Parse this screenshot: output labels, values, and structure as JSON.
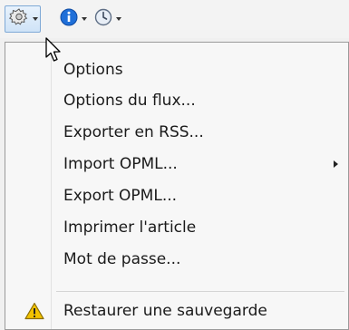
{
  "toolbar": {
    "buttons": [
      {
        "icon": "gear-icon",
        "has_dropdown": true,
        "active": true
      },
      {
        "icon": "info-icon",
        "has_dropdown": true,
        "active": false
      },
      {
        "icon": "clock-icon",
        "has_dropdown": true,
        "active": false
      }
    ]
  },
  "menu": {
    "items": [
      {
        "label": "Options"
      },
      {
        "label": "Options du flux..."
      },
      {
        "label": "Exporter en RSS..."
      },
      {
        "label": "Import OPML...",
        "has_submenu": true
      },
      {
        "label": "Export OPML..."
      },
      {
        "label": "Imprimer l'article"
      },
      {
        "label": "Mot de passe..."
      },
      {
        "label": "Restaurer une sauvegarde",
        "icon": "warning-icon"
      }
    ]
  },
  "colors": {
    "menu_background": "#f7f7f7",
    "active_button_border": "#7fa9d6",
    "info_icon": "#1f6fd8",
    "warning_icon": "#f2c200"
  }
}
